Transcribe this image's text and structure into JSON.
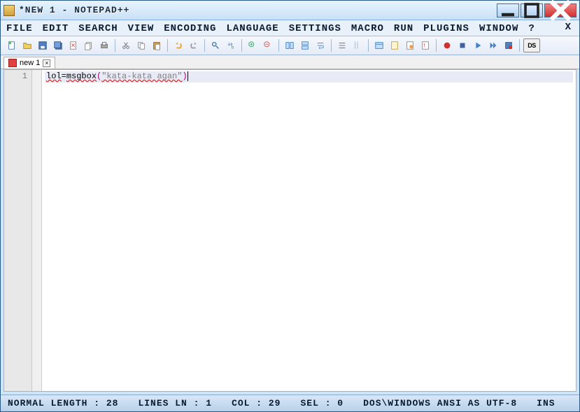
{
  "window": {
    "title": "*NEW 1 - NOTEPAD++"
  },
  "menu": {
    "file": "FILE",
    "edit": "EDIT",
    "search": "SEARCH",
    "view": "VIEW",
    "encoding": "ENCODING",
    "language": "LANGUAGE",
    "settings": "SETTINGS",
    "macro": "MACRO",
    "run": "RUN",
    "plugins": "PLUGINS",
    "window": "WINDOW",
    "help": "?"
  },
  "close_x": "X",
  "tab": {
    "label": "new 1",
    "close": "×"
  },
  "editor": {
    "line_number": "1",
    "code_var": "lol",
    "code_eq": "=",
    "code_fn": "msgbox",
    "code_p1": "(",
    "code_str": "\"kata-kata agan\"",
    "code_p2": ")"
  },
  "status": {
    "length": "NORMAL LENGTH : 28",
    "lines": "LINES LN : 1",
    "col": "COL : 29",
    "sel": "SEL : 0",
    "enc": "DOS\\WINDOWS ANSI AS UTF-8",
    "ins": "INS"
  },
  "toolbar_ds": "DS"
}
